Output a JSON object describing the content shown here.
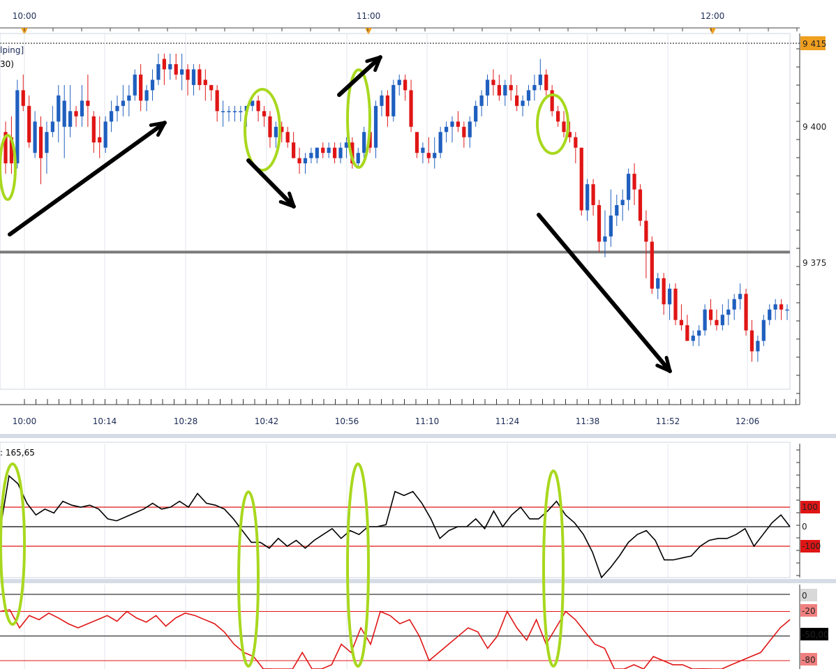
{
  "chart_data": [
    {
      "type": "candlestick",
      "title": "",
      "legend_fragments": [
        "lping]",
        "30)"
      ],
      "top_time_labels": [
        "10:00",
        "11:00",
        "12:00"
      ],
      "x_tick_labels": [
        "10:00",
        "10:14",
        "10:28",
        "10:42",
        "10:56",
        "11:10",
        "11:24",
        "11:38",
        "11:52",
        "12:06"
      ],
      "y_tick_labels": [
        "9 400",
        "9 375"
      ],
      "last_price_label": "9 415",
      "ylim": [
        9352,
        9418
      ],
      "horizontal_line": 9378,
      "colors": {
        "up": "#1f5fbf",
        "down": "#e01515",
        "highlight": "#a8d81e",
        "last_price_bg": "#f0a020"
      },
      "candles": [
        [
          9401,
          9403,
          9393,
          9395
        ],
        [
          9400,
          9404,
          9393,
          9395
        ],
        [
          9395,
          9411,
          9394,
          9409
        ],
        [
          9409,
          9412,
          9405,
          9406
        ],
        [
          9406,
          9408,
          9398,
          9399
        ],
        [
          9397,
          9405,
          9396,
          9403
        ],
        [
          9402,
          9404,
          9391,
          9396
        ],
        [
          9397,
          9403,
          9393,
          9401
        ],
        [
          9401,
          9406,
          9400,
          9403
        ],
        [
          9403,
          9410,
          9399,
          9408
        ],
        [
          9402,
          9410,
          9396,
          9407
        ],
        [
          9402,
          9410,
          9400,
          9405
        ],
        [
          9405,
          9406,
          9402,
          9404
        ],
        [
          9404,
          9410,
          9402,
          9407
        ],
        [
          9407,
          9412,
          9402,
          9406
        ],
        [
          9404,
          9405,
          9397,
          9399
        ],
        [
          9400,
          9404,
          9396,
          9399
        ],
        [
          9398,
          9404,
          9397,
          9403
        ],
        [
          9403,
          9407,
          9401,
          9405
        ],
        [
          9405,
          9408,
          9403,
          9406
        ],
        [
          9406,
          9410,
          9404,
          9407
        ],
        [
          9407,
          9410,
          9404,
          9408
        ],
        [
          9408,
          9413,
          9407,
          9412
        ],
        [
          9412,
          9414,
          9405,
          9407
        ],
        [
          9407,
          9410,
          9405,
          9409
        ],
        [
          9409,
          9413,
          9407,
          9411
        ],
        [
          9411,
          9416,
          9410,
          9414
        ],
        [
          9415,
          9416,
          9410,
          9413
        ],
        [
          9413,
          9416,
          9411,
          9414
        ],
        [
          9414,
          9416,
          9411,
          9412
        ],
        [
          9412,
          9416,
          9409,
          9413
        ],
        [
          9413,
          9414,
          9408,
          9411
        ],
        [
          9410,
          9414,
          9408,
          9413
        ],
        [
          9413,
          9414,
          9409,
          9410
        ],
        [
          9411,
          9413,
          9407,
          9410
        ],
        [
          9410,
          9410,
          9407,
          9409
        ],
        [
          9409,
          9410,
          9403,
          9405
        ],
        [
          9405,
          9407,
          9402,
          9405
        ],
        [
          9405,
          9406,
          9403,
          9405
        ],
        [
          9405,
          9406,
          9403,
          9405
        ],
        [
          9405,
          9406,
          9403,
          9405
        ],
        [
          9405,
          9406,
          9402,
          9406
        ],
        [
          9406,
          9407,
          9405,
          9407
        ],
        [
          9407,
          9408,
          9403,
          9405
        ],
        [
          9405,
          9406,
          9402,
          9404
        ],
        [
          9404,
          9405,
          9398,
          9400
        ],
        [
          9400,
          9403,
          9398,
          9402
        ],
        [
          9402,
          9403,
          9399,
          9401
        ],
        [
          9401,
          9402,
          9398,
          9399
        ],
        [
          9399,
          9401,
          9396,
          9396
        ],
        [
          9396,
          9398,
          9393,
          9395
        ],
        [
          9395,
          9397,
          9393,
          9396
        ],
        [
          9396,
          9398,
          9395,
          9397
        ],
        [
          9396,
          9398,
          9395,
          9398
        ],
        [
          9398,
          9399,
          9396,
          9397
        ],
        [
          9397,
          9399,
          9396,
          9398
        ],
        [
          9398,
          9399,
          9395,
          9396
        ],
        [
          9396,
          9399,
          9395,
          9398
        ],
        [
          9398,
          9400,
          9396,
          9399
        ],
        [
          9399,
          9400,
          9394,
          9395
        ],
        [
          9395,
          9398,
          9394,
          9397
        ],
        [
          9397,
          9402,
          9396,
          9401
        ],
        [
          9401,
          9402,
          9397,
          9398
        ],
        [
          9398,
          9407,
          9396,
          9406
        ],
        [
          9406,
          9409,
          9404,
          9408
        ],
        [
          9408,
          9409,
          9402,
          9404
        ],
        [
          9404,
          9411,
          9403,
          9410
        ],
        [
          9410,
          9412,
          9408,
          9411
        ],
        [
          9411,
          9412,
          9407,
          9409
        ],
        [
          9409,
          9411,
          9401,
          9402
        ],
        [
          9401,
          9399,
          9396,
          9397
        ],
        [
          9397,
          9399,
          9395,
          9398
        ],
        [
          9397,
          9400,
          9395,
          9396
        ],
        [
          9396,
          9400,
          9394,
          9397
        ],
        [
          9397,
          9402,
          9396,
          9401
        ],
        [
          9401,
          9403,
          9399,
          9402
        ],
        [
          9402,
          9404,
          9399,
          9403
        ],
        [
          9403,
          9405,
          9401,
          9402
        ],
        [
          9402,
          9403,
          9398,
          9400
        ],
        [
          9400,
          9404,
          9398,
          9403
        ],
        [
          9403,
          9407,
          9402,
          9406
        ],
        [
          9406,
          9409,
          9404,
          9408
        ],
        [
          9408,
          9412,
          9406,
          9411
        ],
        [
          9411,
          9413,
          9408,
          9410
        ],
        [
          9410,
          9412,
          9407,
          9408
        ],
        [
          9408,
          9411,
          9406,
          9410
        ],
        [
          9410,
          9412,
          9407,
          9409
        ],
        [
          9408,
          9410,
          9405,
          9406
        ],
        [
          9406,
          9408,
          9404,
          9407
        ],
        [
          9407,
          9410,
          9406,
          9409
        ],
        [
          9409,
          9412,
          9407,
          9410
        ],
        [
          9410,
          9415,
          9409,
          9412
        ],
        [
          9412,
          9413,
          9408,
          9409
        ],
        [
          9409,
          9410,
          9404,
          9405
        ],
        [
          9405,
          9406,
          9402,
          9403
        ],
        [
          9403,
          9405,
          9400,
          9401
        ],
        [
          9401,
          9403,
          9399,
          9400
        ],
        [
          9400,
          9401,
          9395,
          9398
        ],
        [
          9398,
          9396,
          9385,
          9386
        ],
        [
          9386,
          9392,
          9384,
          9391
        ],
        [
          9391,
          9392,
          9385,
          9387
        ],
        [
          9387,
          9388,
          9378,
          9380
        ],
        [
          9380,
          9386,
          9377,
          9381
        ],
        [
          9381,
          9390,
          9379,
          9385
        ],
        [
          9385,
          9389,
          9383,
          9387
        ],
        [
          9387,
          9390,
          9384,
          9388
        ],
        [
          9388,
          9394,
          9386,
          9393
        ],
        [
          9393,
          9395,
          9387,
          9390
        ],
        [
          9390,
          9391,
          9383,
          9384
        ],
        [
          9384,
          9386,
          9373,
          9380
        ],
        [
          9380,
          9381,
          9370,
          9371
        ],
        [
          9371,
          9374,
          9369,
          9373
        ],
        [
          9373,
          9374,
          9366,
          9368
        ],
        [
          9368,
          9372,
          9365,
          9371
        ],
        [
          9371,
          9372,
          9364,
          9365
        ],
        [
          9365,
          9368,
          9363,
          9364
        ],
        [
          9364,
          9366,
          9361,
          9361
        ],
        [
          9361,
          9363,
          9360,
          9362
        ],
        [
          9362,
          9364,
          9360,
          9363
        ],
        [
          9363,
          9368,
          9362,
          9367
        ],
        [
          9367,
          9369,
          9364,
          9365
        ],
        [
          9365,
          9367,
          9363,
          9364
        ],
        [
          9364,
          9368,
          9363,
          9366
        ],
        [
          9366,
          9369,
          9364,
          9367
        ],
        [
          9367,
          9370,
          9365,
          9369
        ],
        [
          9369,
          9372,
          9367,
          9370
        ],
        [
          9370,
          9371,
          9362,
          9363
        ],
        [
          9363,
          9365,
          9357,
          9359
        ],
        [
          9359,
          9362,
          9357,
          9361
        ],
        [
          9361,
          9366,
          9360,
          9365
        ],
        [
          9365,
          9368,
          9364,
          9367
        ],
        [
          9367,
          9369,
          9365,
          9368
        ],
        [
          9368,
          9369,
          9365,
          9367
        ],
        [
          9367,
          9368,
          9365,
          9367
        ]
      ]
    },
    {
      "type": "line",
      "title_fragment": ": 165,65",
      "y_tick_labels": [
        "100",
        "0",
        "-100"
      ],
      "ylim": [
        -260,
        300
      ],
      "series": [
        {
          "values": [
            -20,
            260,
            220,
            120,
            60,
            90,
            70,
            130,
            110,
            100,
            110,
            90,
            40,
            30,
            50,
            70,
            90,
            120,
            90,
            100,
            130,
            100,
            170,
            120,
            110,
            90,
            40,
            -20,
            -80,
            -80,
            -110,
            -60,
            -100,
            -70,
            -110,
            -70,
            -40,
            -10,
            -60,
            -20,
            -40,
            0,
            0,
            10,
            180,
            160,
            180,
            120,
            40,
            -60,
            -20,
            0,
            0,
            40,
            -10,
            80,
            0,
            60,
            100,
            40,
            40,
            80,
            130,
            60,
            20,
            -40,
            -130,
            -270,
            -210,
            -150,
            -80,
            -40,
            -20,
            -70,
            -170,
            -170,
            -160,
            -150,
            -100,
            -70,
            -60,
            -60,
            -40,
            -10,
            -100,
            -40,
            20,
            60,
            0
          ]
        }
      ]
    },
    {
      "type": "line",
      "y_tick_labels": [
        "0",
        "-20",
        "-50,00",
        "-80"
      ],
      "ylim": [
        -100,
        5
      ],
      "series": [
        {
          "values": [
            -20,
            -18,
            -40,
            -25,
            -30,
            -22,
            -28,
            -35,
            -40,
            -35,
            -30,
            -25,
            -32,
            -20,
            -28,
            -33,
            -25,
            -38,
            -28,
            -22,
            -25,
            -30,
            -35,
            -45,
            -60,
            -70,
            -75,
            -90,
            -100,
            -100,
            -95,
            -70,
            -100,
            -90,
            -85,
            -60,
            -70,
            -40,
            -60,
            -20,
            -25,
            -35,
            -30,
            -50,
            -80,
            -70,
            -60,
            -50,
            -40,
            -45,
            -65,
            -50,
            -20,
            -40,
            -55,
            -30,
            -60,
            -40,
            -20,
            -30,
            -45,
            -60,
            -65,
            -100,
            -100,
            -85,
            -95,
            -75,
            -80,
            -85,
            -85,
            -95,
            -90,
            -100,
            -95,
            -85,
            -80,
            -75,
            -70,
            -55,
            -40,
            -30
          ]
        }
      ]
    }
  ]
}
